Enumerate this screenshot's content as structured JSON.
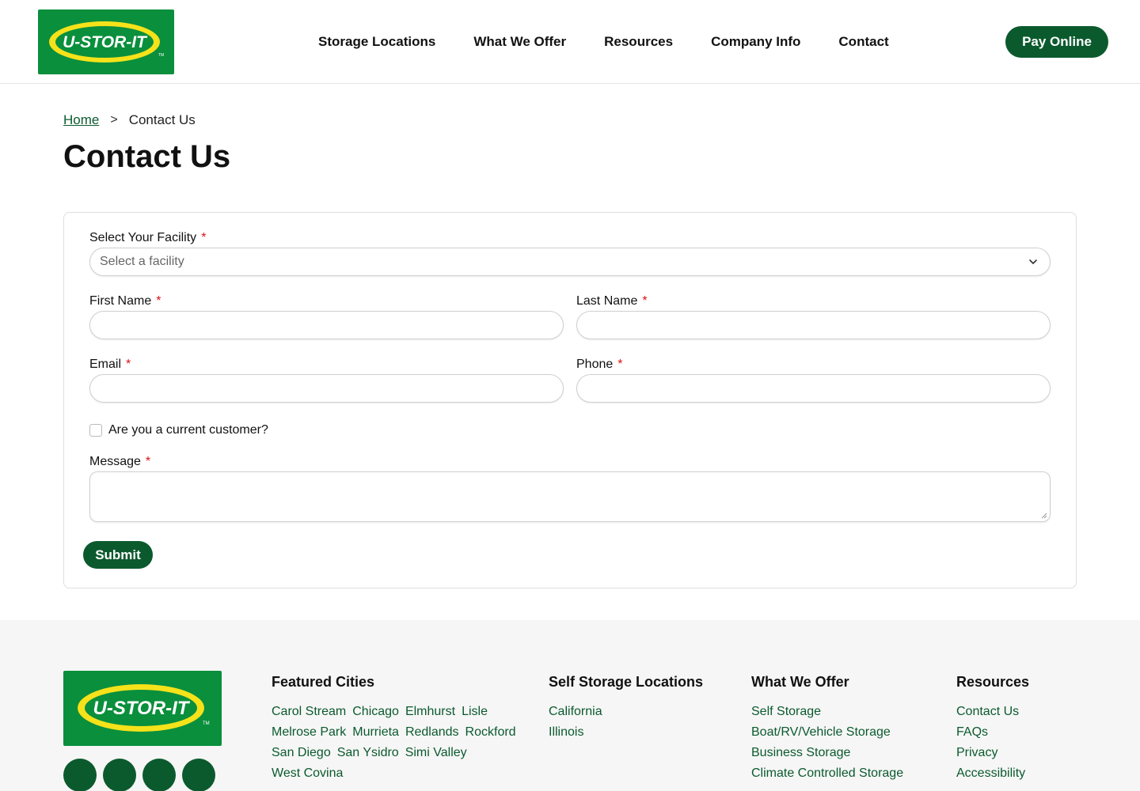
{
  "brand": {
    "logo_text": "U-STOR-IT",
    "trademark": "TM",
    "colors": {
      "primary_green": "#0a8f3c",
      "dark_green": "#0b5a2e",
      "logo_yellow": "#f5e21a"
    }
  },
  "header": {
    "nav": [
      {
        "label": "Storage Locations"
      },
      {
        "label": "What We Offer"
      },
      {
        "label": "Resources"
      },
      {
        "label": "Company Info"
      },
      {
        "label": "Contact"
      }
    ],
    "pay_online_label": "Pay Online"
  },
  "breadcrumb": {
    "home": "Home",
    "separator": ">",
    "current": "Contact Us"
  },
  "page_title": "Contact Us",
  "form": {
    "facility": {
      "label": "Select Your Facility",
      "required": "*",
      "placeholder": "Select a facility"
    },
    "first_name": {
      "label": "First Name",
      "required": "*",
      "value": ""
    },
    "last_name": {
      "label": "Last Name",
      "required": "*",
      "value": ""
    },
    "email": {
      "label": "Email",
      "required": "*",
      "value": ""
    },
    "phone": {
      "label": "Phone",
      "required": "*",
      "value": ""
    },
    "current_customer": {
      "label": "Are you a current customer?",
      "checked": false
    },
    "message": {
      "label": "Message",
      "required": "*",
      "value": ""
    },
    "submit_label": "Submit"
  },
  "footer": {
    "featured_cities": {
      "heading": "Featured Cities",
      "items": [
        "Carol Stream",
        "Chicago",
        "Elmhurst",
        "Lisle",
        "Melrose Park",
        "Murrieta",
        "Redlands",
        "Rockford",
        "San Diego",
        "San Ysidro",
        "Simi Valley",
        "West Covina"
      ]
    },
    "locations": {
      "heading": "Self Storage Locations",
      "items": [
        "California",
        "Illinois"
      ]
    },
    "offer": {
      "heading": "What We Offer",
      "items": [
        "Self Storage",
        "Boat/RV/Vehicle Storage",
        "Business Storage",
        "Climate Controlled Storage"
      ]
    },
    "resources": {
      "heading": "Resources",
      "items": [
        "Contact Us",
        "FAQs",
        "Privacy",
        "Accessibility"
      ]
    },
    "social_icons": [
      "social-icon-1",
      "social-icon-2",
      "social-icon-3",
      "social-icon-4"
    ]
  }
}
